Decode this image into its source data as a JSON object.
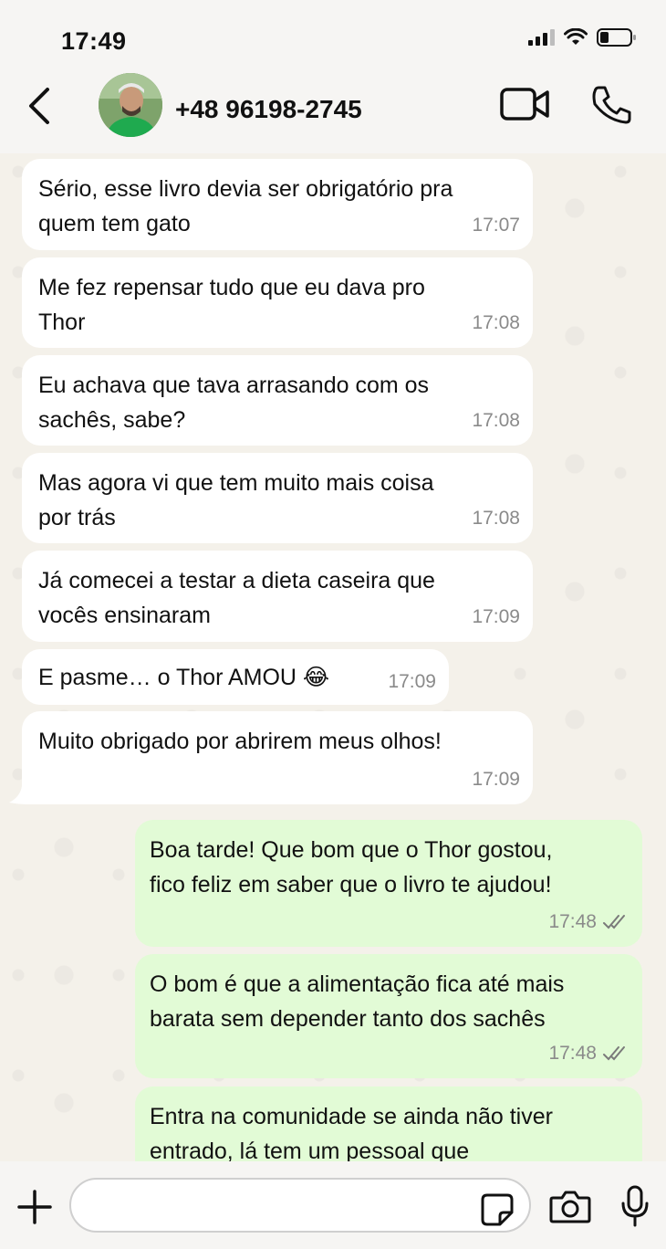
{
  "status_bar": {
    "time": "17:49"
  },
  "header": {
    "contact_name": "+48 96198-2745"
  },
  "messages": [
    {
      "direction": "in",
      "text": "Sério, esse livro devia ser obrigatório pra\nquem tem gato",
      "time": "17:07"
    },
    {
      "direction": "in",
      "text": "Me fez repensar tudo que eu dava pro\nThor",
      "time": "17:08"
    },
    {
      "direction": "in",
      "text": "Eu achava que tava arrasando com os\nsachês, sabe?",
      "time": "17:08"
    },
    {
      "direction": "in",
      "text": "Mas agora vi que tem muito mais coisa\npor trás",
      "time": "17:08"
    },
    {
      "direction": "in",
      "text": "Já comecei a testar a dieta caseira que\nvocês ensinaram",
      "time": "17:09"
    },
    {
      "direction": "in",
      "text": "E pasme… o Thor AMOU 😂",
      "time": "17:09"
    },
    {
      "direction": "in",
      "text": "Muito obrigado por abrirem meus olhos!",
      "time": "17:09"
    },
    {
      "direction": "out",
      "text": "Boa tarde! Que bom que o Thor gostou,\nfico feliz em saber que o livro te ajudou!",
      "time": "17:48",
      "status": "read"
    },
    {
      "direction": "out",
      "text": "O bom é que a alimentação fica até mais\nbarata sem depender tanto dos sachês",
      "time": "17:48",
      "status": "read"
    },
    {
      "direction": "out",
      "text": "Entra na comunidade se ainda não tiver\nentrado, lá tem um pessoal que",
      "time": "",
      "status": ""
    }
  ],
  "input": {
    "placeholder": ""
  },
  "icons": {
    "back": "chevron-left-icon",
    "video": "video-camera-icon",
    "call": "phone-icon",
    "plus": "plus-icon",
    "sticker": "sticker-icon",
    "camera": "camera-icon",
    "mic": "microphone-icon"
  },
  "colors": {
    "incoming_bubble": "#ffffff",
    "outgoing_bubble": "#e2fbd6",
    "chat_background": "#f4f1ea",
    "read_ticks": "#7a7a7a"
  }
}
